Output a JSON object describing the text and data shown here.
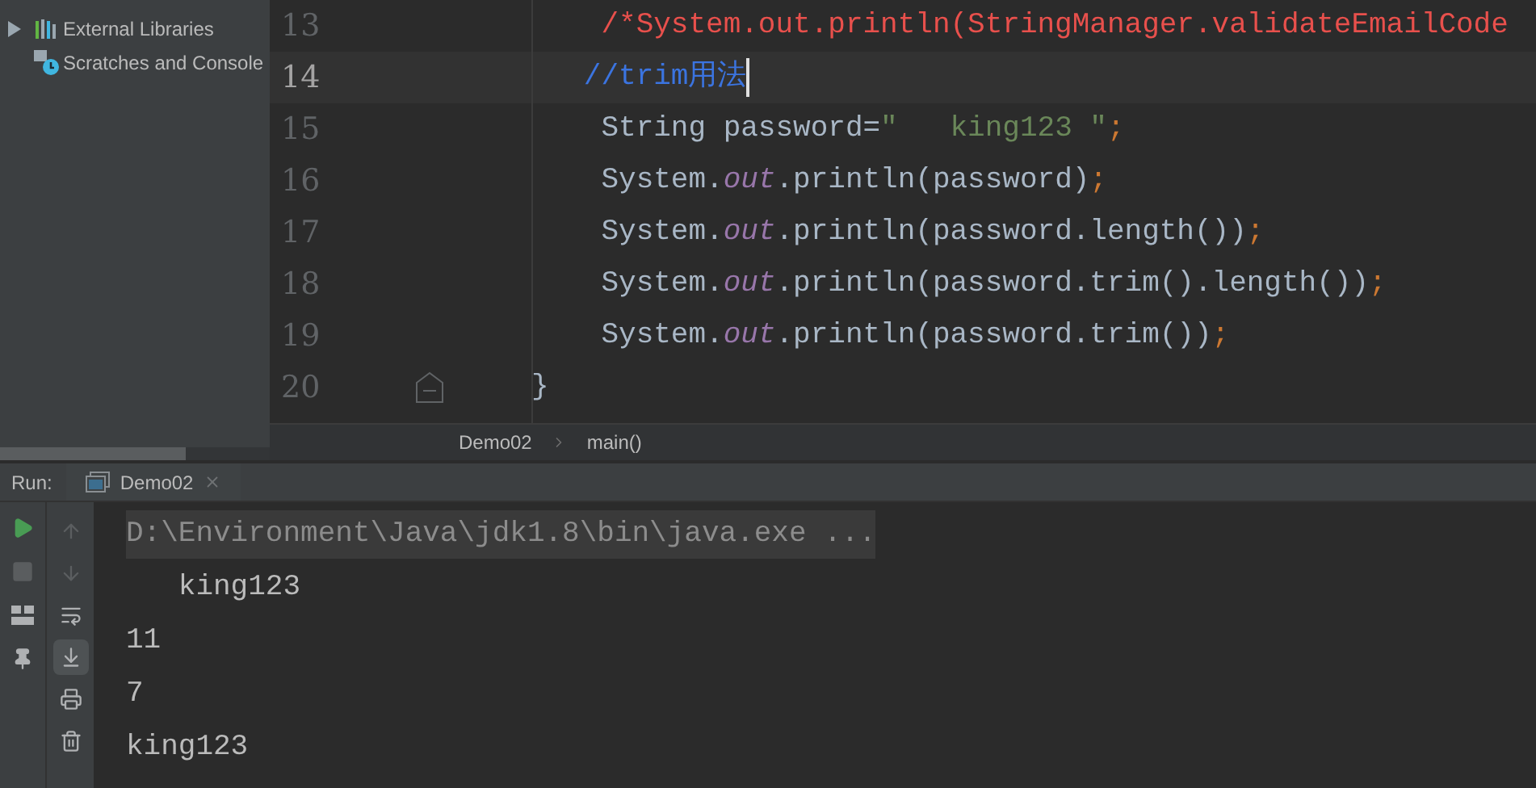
{
  "sidebar": {
    "items": [
      {
        "label": "External Libraries",
        "kind": "library",
        "expanded": false
      },
      {
        "label": "Scratches and Console",
        "kind": "scratch"
      }
    ]
  },
  "editor": {
    "lines": [
      {
        "number": "13",
        "current": false,
        "fold": false,
        "tokens": [
          {
            "kind": "block-comment",
            "text": "         /*System.out.println(StringManager.validateEmailCode"
          }
        ]
      },
      {
        "number": "14",
        "current": true,
        "fold": false,
        "tokens": [
          {
            "kind": "line-comment",
            "text": "        //trim用法"
          }
        ]
      },
      {
        "number": "15",
        "current": false,
        "fold": false,
        "tokens": [
          {
            "text": "         String password="
          },
          {
            "kind": "string",
            "text": "\"   king123 \""
          },
          {
            "kind": "punct",
            "text": ";"
          }
        ]
      },
      {
        "number": "16",
        "current": false,
        "fold": false,
        "tokens": [
          {
            "text": "         System."
          },
          {
            "kind": "field",
            "text": "out"
          },
          {
            "text": ".println(password)"
          },
          {
            "kind": "punct",
            "text": ";"
          }
        ]
      },
      {
        "number": "17",
        "current": false,
        "fold": false,
        "tokens": [
          {
            "text": "         System."
          },
          {
            "kind": "field",
            "text": "out"
          },
          {
            "text": ".println(password.length())"
          },
          {
            "kind": "punct",
            "text": ";"
          }
        ]
      },
      {
        "number": "18",
        "current": false,
        "fold": false,
        "tokens": [
          {
            "text": "         System."
          },
          {
            "kind": "field",
            "text": "out"
          },
          {
            "text": ".println(password.trim().length())"
          },
          {
            "kind": "punct",
            "text": ";"
          }
        ]
      },
      {
        "number": "19",
        "current": false,
        "fold": false,
        "tokens": [
          {
            "text": "         System."
          },
          {
            "kind": "field",
            "text": "out"
          },
          {
            "text": ".println(password.trim())"
          },
          {
            "kind": "punct",
            "text": ";"
          }
        ]
      },
      {
        "number": "20",
        "current": false,
        "fold": true,
        "tokens": [
          {
            "text": "     }"
          }
        ]
      }
    ]
  },
  "breadcrumbs": [
    "Demo02",
    "main()"
  ],
  "run_panel": {
    "label": "Run:",
    "tab": {
      "label": "Demo02"
    },
    "tools": [
      {
        "kind": "run",
        "selected": false
      },
      {
        "kind": "stop",
        "selected": false
      },
      {
        "kind": "layout",
        "selected": false
      },
      {
        "kind": "pin",
        "selected": false
      }
    ],
    "console_tools": [
      {
        "kind": "up",
        "selected": false
      },
      {
        "kind": "down",
        "selected": false
      },
      {
        "kind": "wrap",
        "selected": false
      },
      {
        "kind": "scroll-end",
        "selected": true
      },
      {
        "kind": "print",
        "selected": false
      },
      {
        "kind": "trash",
        "selected": false
      }
    ],
    "output": [
      {
        "kind": "command",
        "text": "D:\\Environment\\Java\\jdk1.8\\bin\\java.exe ..."
      },
      {
        "kind": "stdout",
        "text": "   king123"
      },
      {
        "kind": "stdout",
        "text": "11"
      },
      {
        "kind": "stdout",
        "text": "7"
      },
      {
        "kind": "stdout",
        "text": "king123"
      }
    ]
  }
}
